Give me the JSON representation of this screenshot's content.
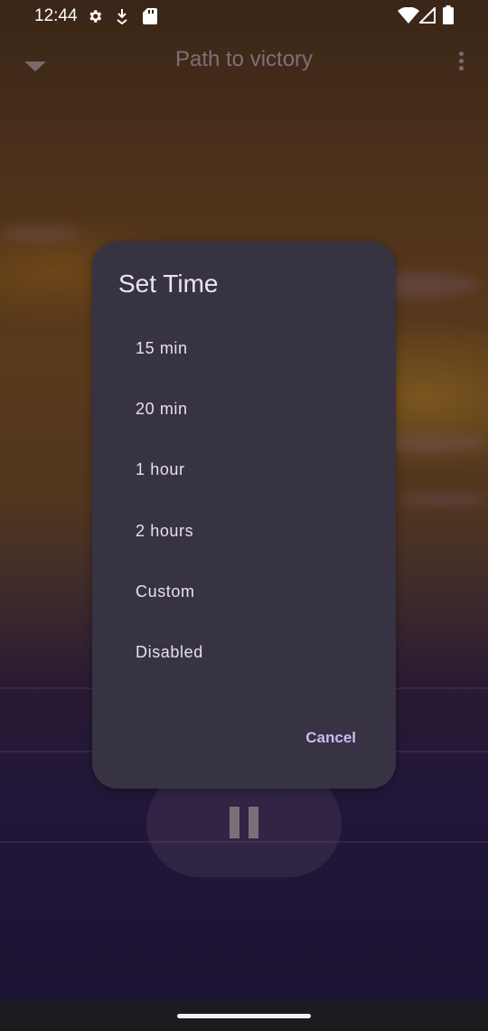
{
  "status_bar": {
    "time": "12:44",
    "left_icons": [
      "settings-icon",
      "download-icon",
      "sd-card-icon"
    ],
    "right_icons": [
      "wifi-icon",
      "signal-icon",
      "battery-icon"
    ]
  },
  "player": {
    "title": "Path to victory",
    "collapse_icon": "chevron-down-icon",
    "menu_icon": "more-vert-icon",
    "play_state_icon": "pause-icon"
  },
  "dialog": {
    "title": "Set Time",
    "options": [
      {
        "label": "15 min"
      },
      {
        "label": "20 min"
      },
      {
        "label": "1 hour"
      },
      {
        "label": "2 hours"
      },
      {
        "label": "Custom"
      },
      {
        "label": "Disabled"
      }
    ],
    "cancel_label": "Cancel"
  },
  "colors": {
    "dialog_background": "#373343",
    "accent": "#cdb9f2",
    "text_primary": "#e7e1ea"
  }
}
